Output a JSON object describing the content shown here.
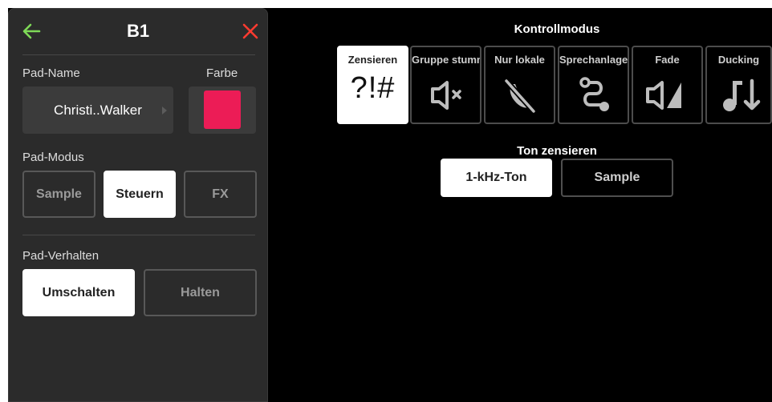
{
  "panel": {
    "title": "B1",
    "pad_name_label": "Pad-Name",
    "color_label": "Farbe",
    "pad_name_value": "Christi..Walker",
    "color_value": "#ec1c56",
    "pad_mode_label": "Pad-Modus",
    "pad_modes": [
      {
        "label": "Sample",
        "active": false
      },
      {
        "label": "Steuern",
        "active": true
      },
      {
        "label": "FX",
        "active": false
      }
    ],
    "pad_behavior_label": "Pad-Verhalten",
    "behaviors": [
      {
        "label": "Umschalten",
        "active": true
      },
      {
        "label": "Halten",
        "active": false
      }
    ],
    "back_icon": "arrow-left-icon",
    "close_icon": "close-x-icon",
    "accent_back": "#7ed957",
    "accent_close": "#ff3b30"
  },
  "control": {
    "title": "Kontrollmodus",
    "modes": [
      {
        "label": "Zensieren",
        "icon": "censor-icon",
        "glyph": "?!#",
        "active": true
      },
      {
        "label": "Gruppe stumm",
        "icon": "speaker-mute-icon",
        "active": false
      },
      {
        "label": "Nur lokale",
        "icon": "phone-off-icon",
        "active": false
      },
      {
        "label": "Sprechanlage",
        "icon": "route-icon",
        "active": false
      },
      {
        "label": "Fade",
        "icon": "fade-icon",
        "active": false
      },
      {
        "label": "Ducking",
        "icon": "ducking-icon",
        "active": false
      }
    ]
  },
  "tone": {
    "title": "Ton zensieren",
    "options": [
      {
        "label": "1-kHz-Ton",
        "active": true
      },
      {
        "label": "Sample",
        "active": false
      }
    ]
  }
}
